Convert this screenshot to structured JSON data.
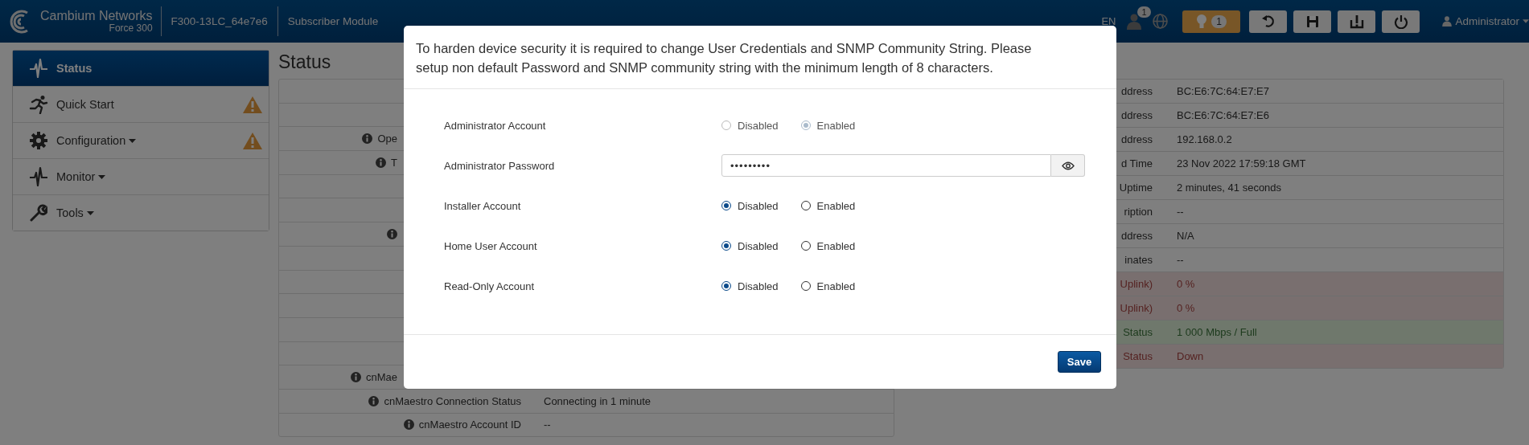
{
  "header": {
    "brand": "Cambium Networks",
    "model": "Force 300",
    "device_name": "F300-13LC_64e7e6",
    "device_role": "Subscriber Module",
    "language": "EN",
    "users_badge": "1",
    "alerts_badge": "1",
    "user": "Administrator"
  },
  "sidebar": {
    "items": [
      {
        "label": "Status",
        "selected": true,
        "dropdown": false,
        "warning": false
      },
      {
        "label": "Quick Start",
        "selected": false,
        "dropdown": false,
        "warning": true
      },
      {
        "label": "Configuration",
        "selected": false,
        "dropdown": true,
        "warning": true
      },
      {
        "label": "Monitor",
        "selected": false,
        "dropdown": true,
        "warning": false
      },
      {
        "label": "Tools",
        "selected": false,
        "dropdown": true,
        "warning": false
      }
    ]
  },
  "page_title": "Status",
  "left_table": {
    "rows": [
      {
        "info": false
      },
      {
        "info": false
      },
      {
        "info": true,
        "label": "Ope",
        "covered": true
      },
      {
        "info": true,
        "label": "T",
        "covered": true
      },
      {
        "info": false
      },
      {
        "info": false
      },
      {
        "info": true,
        "covered": true
      },
      {
        "info": false
      },
      {
        "info": false
      },
      {
        "info": false
      },
      {
        "info": false
      },
      {
        "info": false
      },
      {
        "info": true,
        "label": "cnMae",
        "covered": true
      },
      {
        "info": true,
        "label": "cnMaestro Connection Status",
        "value": "Connecting in 1 minute",
        "covered": false
      },
      {
        "info": true,
        "label": "cnMaestro Account ID",
        "value": "--",
        "covered": false
      }
    ]
  },
  "right_table": {
    "rows": [
      {
        "label": "ddress",
        "value": "BC:E6:7C:64:E7:E7",
        "error": false,
        "ok": false
      },
      {
        "label": "ddress",
        "value": "BC:E6:7C:64:E7:E6",
        "error": false,
        "ok": false
      },
      {
        "label": "ddress",
        "value": "192.168.0.2",
        "error": false,
        "ok": false
      },
      {
        "label": "d Time",
        "value": "23 Nov 2022 17:59:18 GMT",
        "error": false,
        "ok": false
      },
      {
        "label": "Uptime",
        "value": "2 minutes, 41 seconds",
        "error": false,
        "ok": false
      },
      {
        "label": "ription",
        "value": "--",
        "error": false,
        "ok": false
      },
      {
        "label": "ddress",
        "value": "N/A",
        "error": false,
        "ok": false
      },
      {
        "label": "inates",
        "value": "--",
        "error": false,
        "ok": false
      },
      {
        "label": "Uplink)",
        "value": "0 %",
        "error": true,
        "ok": false
      },
      {
        "label": "Uplink)",
        "value": "0 %",
        "error": true,
        "ok": false
      },
      {
        "label": "Status",
        "value": "1 000 Mbps / Full",
        "error": false,
        "ok": true
      },
      {
        "label": "Status",
        "value": "Down",
        "error": true,
        "ok": false
      }
    ]
  },
  "modal": {
    "message": "To harden device security it is required to change User Credentials and SNMP Community String. Please setup non default Password and SNMP community string with the minimum length of 8 characters.",
    "rows": [
      {
        "kind": "radio",
        "label": "Administrator Account",
        "disabled": true,
        "options": [
          {
            "label": "Disabled",
            "selected": false
          },
          {
            "label": "Enabled",
            "selected": true
          }
        ]
      },
      {
        "kind": "password",
        "label": "Administrator Password",
        "value": "•••••••••"
      },
      {
        "kind": "radio",
        "label": "Installer Account",
        "disabled": false,
        "options": [
          {
            "label": "Disabled",
            "selected": true
          },
          {
            "label": "Enabled",
            "selected": false
          }
        ]
      },
      {
        "kind": "radio",
        "label": "Home User Account",
        "disabled": false,
        "options": [
          {
            "label": "Disabled",
            "selected": true
          },
          {
            "label": "Enabled",
            "selected": false
          }
        ]
      },
      {
        "kind": "radio",
        "label": "Read-Only Account",
        "disabled": false,
        "options": [
          {
            "label": "Disabled",
            "selected": true
          },
          {
            "label": "Enabled",
            "selected": false
          }
        ]
      }
    ],
    "save": "Save"
  }
}
